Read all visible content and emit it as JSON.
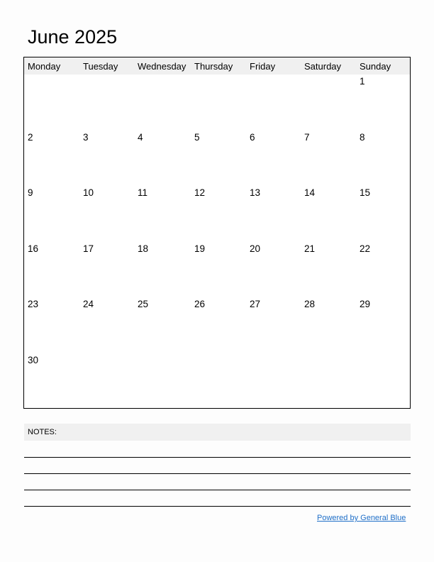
{
  "title": "June 2025",
  "weekdays": [
    "Monday",
    "Tuesday",
    "Wednesday",
    "Thursday",
    "Friday",
    "Saturday",
    "Sunday"
  ],
  "weeks": [
    [
      "",
      "",
      "",
      "",
      "",
      "",
      "1"
    ],
    [
      "2",
      "3",
      "4",
      "5",
      "6",
      "7",
      "8"
    ],
    [
      "9",
      "10",
      "11",
      "12",
      "13",
      "14",
      "15"
    ],
    [
      "16",
      "17",
      "18",
      "19",
      "20",
      "21",
      "22"
    ],
    [
      "23",
      "24",
      "25",
      "26",
      "27",
      "28",
      "29"
    ],
    [
      "30",
      "",
      "",
      "",
      "",
      "",
      ""
    ]
  ],
  "notes_label": "NOTES:",
  "footer_link": "Powered by General Blue",
  "colors": {
    "header_bg": "#f0f0f0",
    "link": "#1f6fc8"
  }
}
